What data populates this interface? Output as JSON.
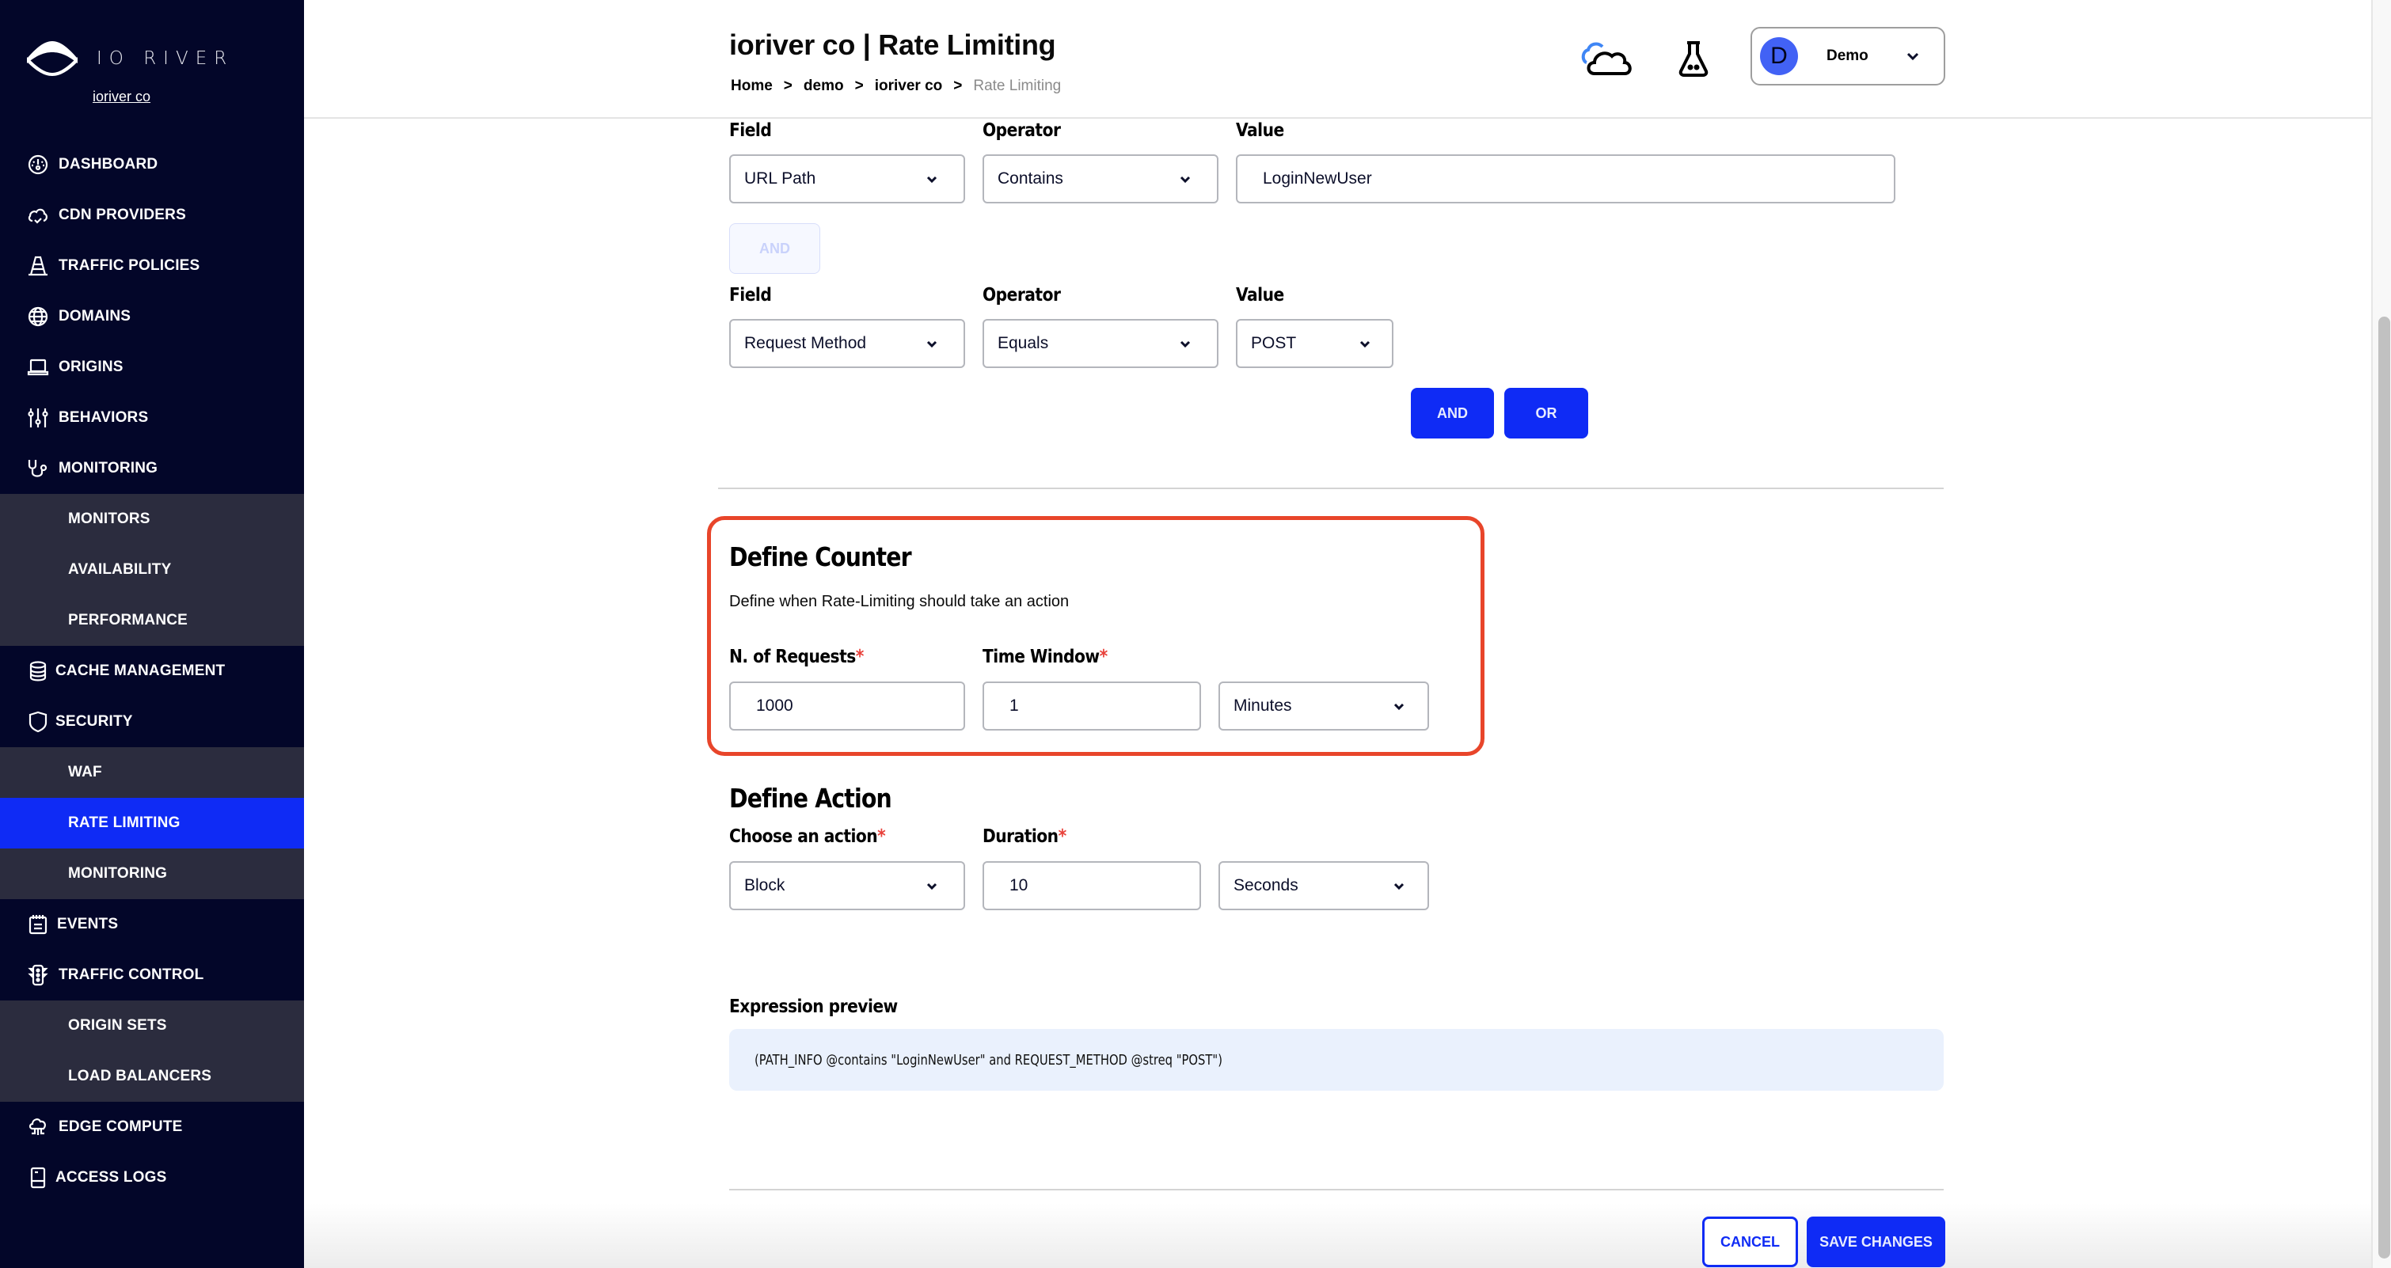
{
  "sidebar": {
    "brand": "IO RIVER",
    "org": "ioriver co",
    "items": [
      {
        "label": "DASHBOARD",
        "icon": "dashboard-icon"
      },
      {
        "label": "CDN PROVIDERS",
        "icon": "cloud-check-icon"
      },
      {
        "label": "TRAFFIC POLICIES",
        "icon": "traffic-cone-icon"
      },
      {
        "label": "DOMAINS",
        "icon": "globe-icon"
      },
      {
        "label": "ORIGINS",
        "icon": "laptop-icon"
      },
      {
        "label": "BEHAVIORS",
        "icon": "sliders-icon"
      },
      {
        "label": "MONITORING",
        "icon": "stethoscope-icon"
      },
      {
        "label": "CACHE MANAGEMENT",
        "icon": "database-icon"
      },
      {
        "label": "SECURITY",
        "icon": "shield-icon"
      },
      {
        "label": "EVENTS",
        "icon": "calendar-icon"
      },
      {
        "label": "TRAFFIC CONTROL",
        "icon": "traffic-light-icon"
      },
      {
        "label": "EDGE COMPUTE",
        "icon": "cloud-compute-icon"
      },
      {
        "label": "ACCESS LOGS",
        "icon": "logs-icon"
      }
    ],
    "monitoring_sub": [
      "MONITORS",
      "AVAILABILITY",
      "PERFORMANCE"
    ],
    "security_sub": [
      "WAF",
      "RATE LIMITING",
      "MONITORING"
    ],
    "traffic_control_sub": [
      "ORIGIN SETS",
      "LOAD BALANCERS"
    ],
    "active": "RATE LIMITING"
  },
  "header": {
    "title": "ioriver co | Rate Limiting",
    "breadcrumb": [
      "Home",
      "demo",
      "ioriver co",
      "Rate Limiting"
    ],
    "breadcrumb_sep": ">",
    "user": {
      "initial": "D",
      "name": "Demo"
    }
  },
  "conditions": {
    "field_label": "Field",
    "operator_label": "Operator",
    "value_label": "Value",
    "rows": [
      {
        "field": "URL Path",
        "operator": "Contains",
        "value": "LoginNewUser"
      },
      {
        "field": "Request Method",
        "operator": "Equals",
        "value": "POST"
      }
    ],
    "connector": "AND",
    "and_button": "AND",
    "or_button": "OR"
  },
  "counter": {
    "title": "Define Counter",
    "description": "Define when Rate-Limiting should take an action",
    "requests_label": "N. of Requests",
    "requests_value": "1000",
    "window_label": "Time Window",
    "window_value": "1",
    "window_unit": "Minutes"
  },
  "action": {
    "title": "Define Action",
    "action_label": "Choose an action",
    "action_value": "Block",
    "duration_label": "Duration",
    "duration_value": "10",
    "duration_unit": "Seconds"
  },
  "expression": {
    "label": "Expression preview",
    "text": "(PATH_INFO @contains \"LoginNewUser\" and REQUEST_METHOD @streq \"POST\")"
  },
  "footer": {
    "cancel": "CANCEL",
    "save": "SAVE CHANGES"
  },
  "required_mark": "*",
  "colors": {
    "accent": "#0f2bf5",
    "sidebar_bg": "#030629",
    "submenu_bg": "#2b2c3e",
    "annotation": "#e8452a",
    "required": "#e8413a"
  }
}
